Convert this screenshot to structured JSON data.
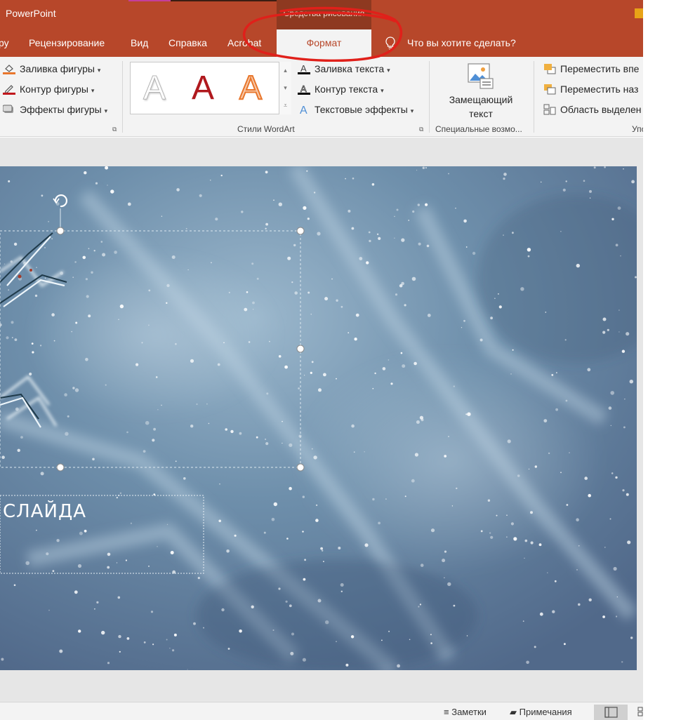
{
  "titlebar": {
    "app_title": "PowerPoint",
    "context_group": "Средства рисования"
  },
  "tabs": {
    "partial_first": "ру",
    "items": [
      "Рецензирование",
      "Вид",
      "Справка",
      "Acrobat"
    ],
    "active": "Формат",
    "tell_me": "Что вы хотите сделать?"
  },
  "ribbon": {
    "shape_styles": {
      "fill": "Заливка фигуры",
      "outline": "Контур фигуры",
      "effects": "Эффекты фигуры"
    },
    "wordart": {
      "letter": "A",
      "text_fill": "Заливка текста",
      "text_outline": "Контур текста",
      "text_effects": "Текстовые эффекты",
      "group_label": "Стили WordArt"
    },
    "accessibility": {
      "alt_text_line1": "Замещающий",
      "alt_text_line2": "текст",
      "group_label": "Специальные возмо..."
    },
    "arrange": {
      "bring_forward": "Переместить впе",
      "send_backward": "Переместить наз",
      "selection_pane": "Область выделен",
      "group_label_partial": "Упо"
    }
  },
  "slide": {
    "subtitle_text": "СЛАЙДА"
  },
  "statusbar": {
    "notes": "Заметки",
    "comments": "Примечания"
  },
  "colors": {
    "accent": "#b7472a",
    "context_tab": "#8e3920",
    "annotation": "#e0201a",
    "wordart_red": "#b0191e",
    "wordart_orange": "#e8762c"
  }
}
